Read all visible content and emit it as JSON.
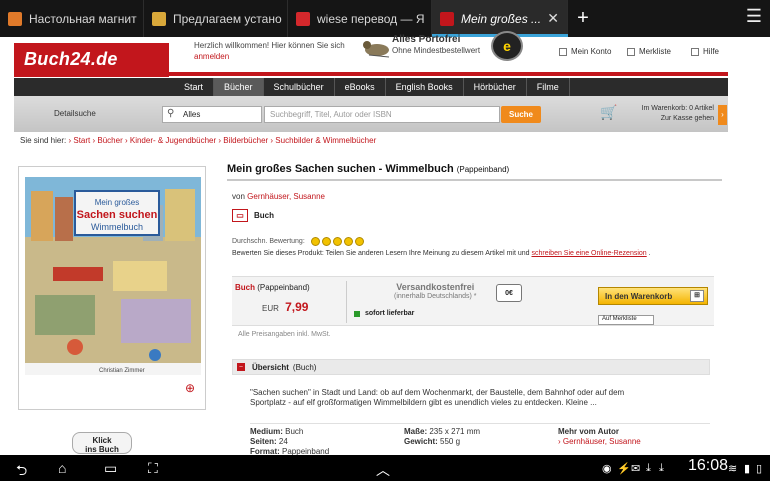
{
  "colors": {
    "brand_red": "#c2161c",
    "accent_orange": "#f08a1c",
    "tab_highlight": "#3aa3d8"
  },
  "browser": {
    "tabs": [
      {
        "title": "Настольная магнит",
        "icon": "bookmark-favicon-icon",
        "active": false
      },
      {
        "title": "Предлагаем устано",
        "icon": "site-favicon-icon",
        "active": false
      },
      {
        "title": "wiese перевод — Я",
        "icon": "yandex-favicon-icon",
        "active": false
      },
      {
        "title": "Mein großes ...",
        "icon": "buch24-favicon-icon",
        "active": true
      }
    ],
    "new_tab": "+",
    "close": "✕",
    "menu": "☰"
  },
  "header": {
    "logo": "Buch24.de",
    "welcome_line1": "Herzlich willkommen! Hier können Sie sich",
    "welcome_link": "anmelden",
    "porto_title": "Alles Portofrei",
    "porto_sub": "Ohne Mindestbestellwert",
    "seal": "e",
    "account_links": [
      "Mein Konto",
      "Merkliste",
      "Hilfe"
    ]
  },
  "nav": {
    "items": [
      "Start",
      "Bücher",
      "Schulbücher",
      "eBooks",
      "English Books",
      "Hörbücher",
      "Filme"
    ],
    "active_index": 1
  },
  "search": {
    "detail": "Detailsuche",
    "category": "Alles",
    "placeholder": "Suchbegriff, Titel, Autor oder ISBN",
    "button": "Suche",
    "cart_line1": "Im Warenkorb: 0 Artikel",
    "cart_line2": "Zur Kasse gehen"
  },
  "breadcrumb": {
    "label": "Sie sind hier:",
    "items": [
      "› Start",
      "› Bücher",
      "› Kinder- & Jugendbücher",
      "› Bilderbücher",
      "› Suchbilder & Wimmelbücher"
    ]
  },
  "product": {
    "title": "Mein großes Sachen suchen - Wimmelbuch",
    "binding": "(Pappeinband)",
    "author_prefix": "von",
    "author": "Gernhäuser, Susanne",
    "type": "Buch",
    "rating_label": "Durchschn. Bewertung:",
    "rating_smileys": 5,
    "review_text": "Bewerten Sie dieses Produkt: Teilen Sie anderen Lesern Ihre Meinung zu diesem Artikel mit und",
    "review_link": "schreiben Sie eine Online-Rezension",
    "review_end": ".",
    "cover_title_line1": "Mein großes",
    "cover_title_line2": "Sachen suchen",
    "cover_title_line3": "Wimmelbuch",
    "cover_illustrator": "Christian Zimmer",
    "klick_line1": "Klick",
    "klick_line2": "ins Buch"
  },
  "buy": {
    "type": "Buch",
    "binding": "(Pappeinband)",
    "currency": "EUR",
    "price": "7,99",
    "shipping": "Versandkostenfrei",
    "shipping_sub": "(innerhalb Deutschlands)",
    "shipping_star": "*",
    "truck_label": "0€",
    "availability": "sofort lieferbar",
    "cart_button": "In den Warenkorb",
    "merkliste_button": "Auf Merkliste",
    "vat": "Alle Preisangaben inkl. MwSt."
  },
  "overview": {
    "toggle": "–",
    "title": "Übersicht",
    "sub": "(Buch)",
    "description": "\"Sachen suchen\" in Stadt und Land: ob auf dem Wochenmarkt, der Baustelle, dem Bahnhof oder auf dem Sportplatz - auf elf großformatigen Wimmelbildern gibt es unendlich vieles zu entdecken. Kleine ...",
    "medium_label": "Medium:",
    "medium": "Buch",
    "pages_label": "Seiten:",
    "pages": "24",
    "format_label": "Format:",
    "format": "Pappeinband",
    "dims_label": "Maße:",
    "dims": "235 x 271 mm",
    "weight_label": "Gewicht:",
    "weight": "550 g",
    "more_label": "Mehr vom Autor",
    "more_link": "› Gernhäuser, Susanne"
  },
  "system": {
    "time": "16:08"
  }
}
